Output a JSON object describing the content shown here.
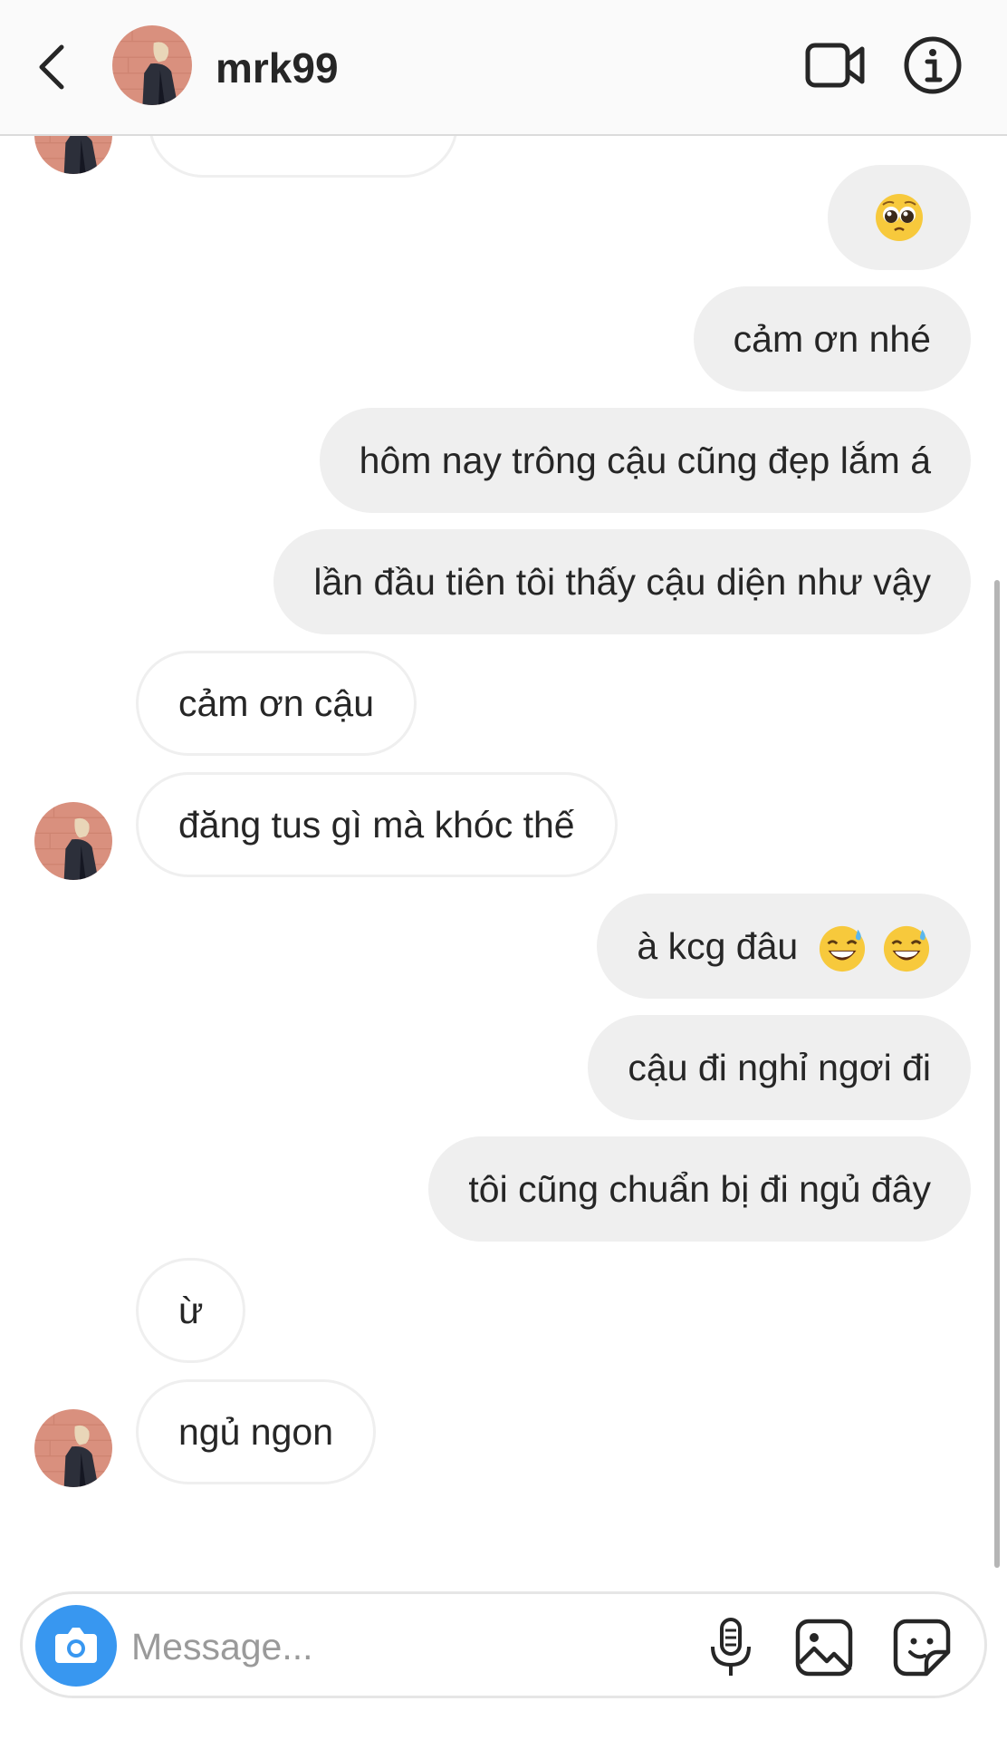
{
  "header": {
    "username": "mrk99",
    "back_icon": "chevron-left-icon",
    "video_icon": "video-camera-icon",
    "info_icon": "info-circle-icon"
  },
  "messages": [
    {
      "side": "out",
      "text": "",
      "emoji": "pleading-face"
    },
    {
      "side": "out",
      "text": "cảm ơn nhé"
    },
    {
      "side": "out",
      "text": "hôm nay trông cậu cũng đẹp lắm á"
    },
    {
      "side": "out",
      "text": "lần đầu tiên tôi thấy cậu diện như vậy"
    },
    {
      "side": "in",
      "text": "cảm ơn cậu"
    },
    {
      "side": "in",
      "text": "đăng tus gì mà khóc thế"
    },
    {
      "side": "out",
      "text": "à kcg đâu",
      "emoji": "grinning-face-with-sweat x2"
    },
    {
      "side": "out",
      "text": "cậu đi nghỉ ngơi đi"
    },
    {
      "side": "out",
      "text": "tôi cũng chuẩn bị đi ngủ đây"
    },
    {
      "side": "in",
      "text": "ừ"
    },
    {
      "side": "in",
      "text": "ngủ ngon"
    }
  ],
  "composer": {
    "placeholder": "Message...",
    "camera_icon": "camera-icon",
    "mic_icon": "microphone-icon",
    "gallery_icon": "image-gallery-icon",
    "sticker_icon": "sticker-icon"
  },
  "colors": {
    "accent": "#3897f0",
    "outgoing_bubble": "#efefef",
    "incoming_border": "#efefef",
    "text": "#262626",
    "placeholder": "#9a9a9a"
  }
}
